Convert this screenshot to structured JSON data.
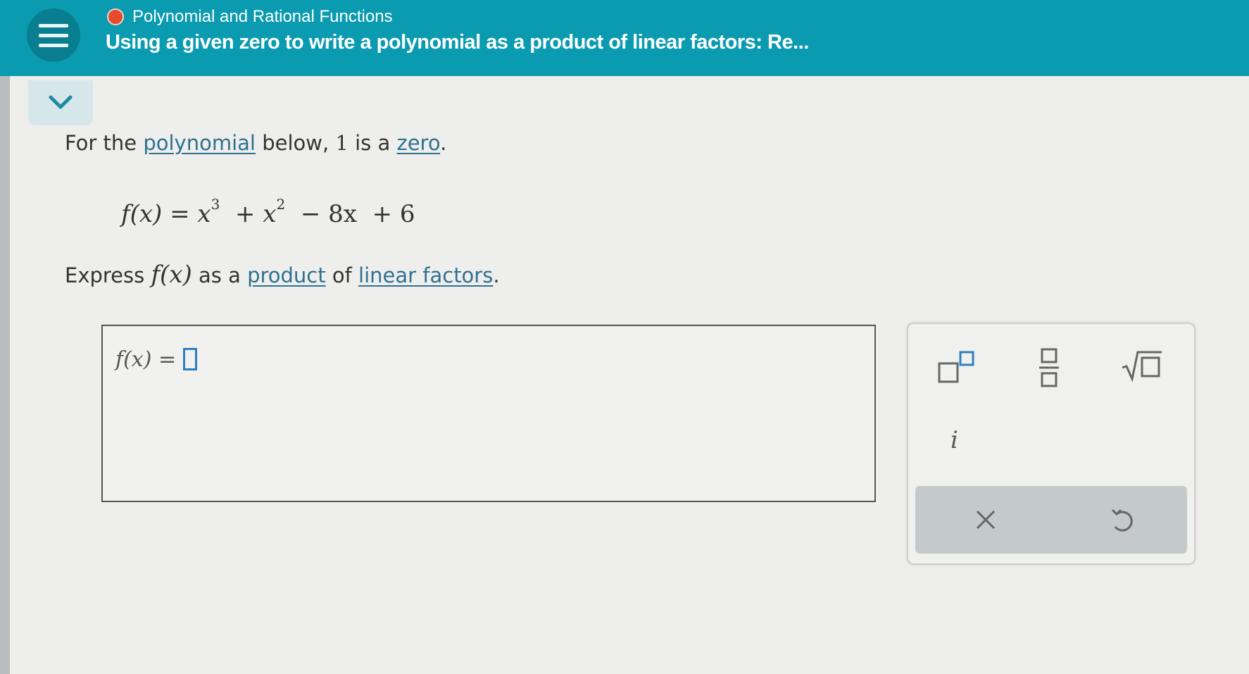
{
  "header": {
    "topic": "Polynomial and Rational Functions",
    "title": "Using a given zero to write a polynomial as a product of linear factors: Re...",
    "accent_color": "#0b9bb0",
    "status_dot_color": "#e54b2c"
  },
  "question": {
    "line1": {
      "prefix": "For the",
      "link_polynomial": "polynomial",
      "middle": "below,",
      "zero_value": "1",
      "is_a": "is a",
      "link_zero": "zero",
      "period": "."
    },
    "equation": {
      "lhs": "f(x)",
      "eq": "=",
      "t1": "x",
      "t1_exp": "3",
      "op1": "+",
      "t2": "x",
      "t2_exp": "2",
      "op2": "−",
      "t3": "8x",
      "op3": "+",
      "t4": "6"
    },
    "line2": {
      "prefix": "Express",
      "fx": "f(x)",
      "middle": "as a",
      "link_product": "product",
      "of": "of",
      "link_linear_factors": "linear factors",
      "period": "."
    }
  },
  "answer": {
    "label": "f(x) ="
  },
  "keypad": {
    "imaginary_unit": "i",
    "icons": [
      "superscript-icon",
      "fraction-icon",
      "square-root-icon",
      "clear-icon",
      "undo-icon"
    ]
  }
}
